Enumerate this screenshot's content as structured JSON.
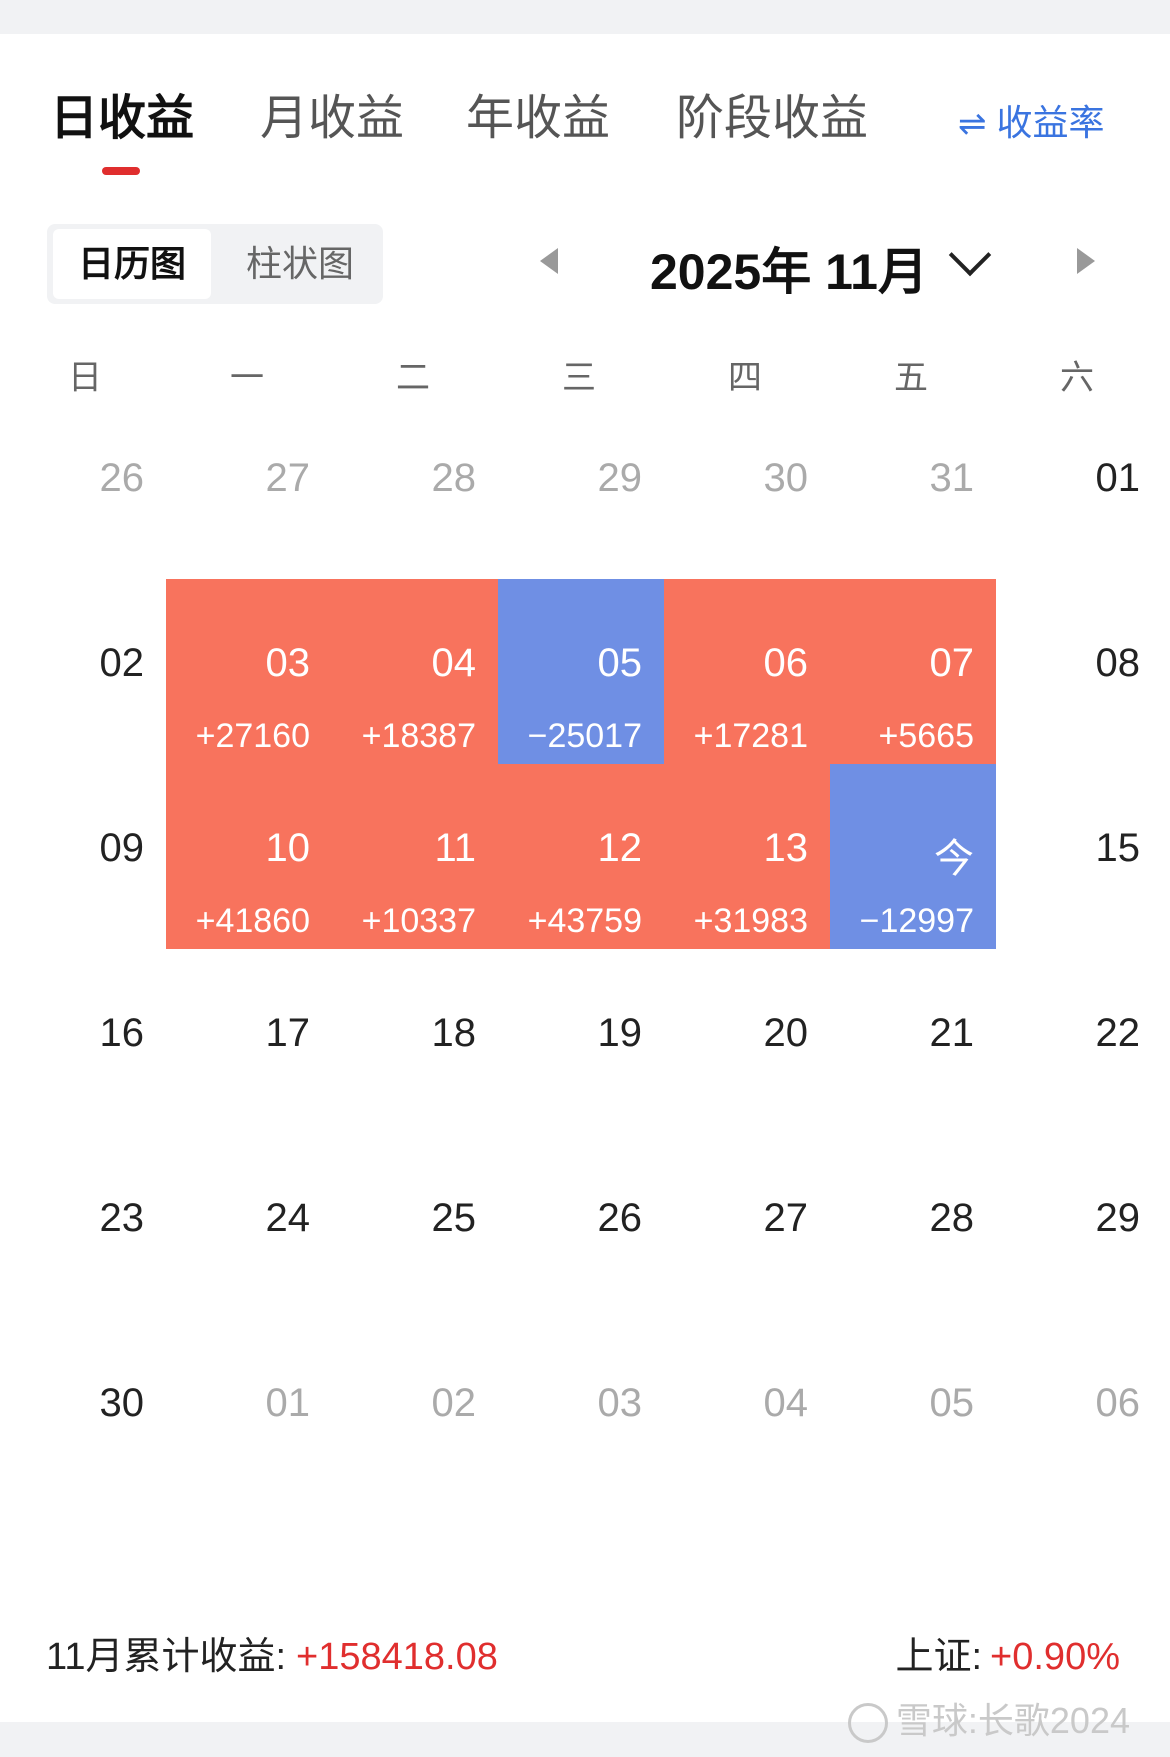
{
  "tabs": [
    {
      "label": "日收益",
      "active": true
    },
    {
      "label": "月收益",
      "active": false
    },
    {
      "label": "年收益",
      "active": false
    },
    {
      "label": "阶段收益",
      "active": false
    }
  ],
  "rate_toggle": {
    "label": "收益率",
    "icon": "swap-icon"
  },
  "view_switch": {
    "calendar": "日历图",
    "bar": "柱状图",
    "selected": "日历图"
  },
  "month_nav": {
    "title": "2025年 11月"
  },
  "weekdays": [
    "日",
    "一",
    "二",
    "三",
    "四",
    "五",
    "六"
  ],
  "calendar": [
    [
      {
        "day": "26",
        "muted": true
      },
      {
        "day": "27",
        "muted": true
      },
      {
        "day": "28",
        "muted": true
      },
      {
        "day": "29",
        "muted": true
      },
      {
        "day": "30",
        "muted": true
      },
      {
        "day": "31",
        "muted": true
      },
      {
        "day": "01"
      }
    ],
    [
      {
        "day": "02"
      },
      {
        "day": "03",
        "value": "+27160",
        "trend": "up"
      },
      {
        "day": "04",
        "value": "+18387",
        "trend": "up"
      },
      {
        "day": "05",
        "value": "−25017",
        "trend": "down"
      },
      {
        "day": "06",
        "value": "+17281",
        "trend": "up"
      },
      {
        "day": "07",
        "value": "+5665",
        "trend": "up"
      },
      {
        "day": "08"
      }
    ],
    [
      {
        "day": "09"
      },
      {
        "day": "10",
        "value": "+41860",
        "trend": "up"
      },
      {
        "day": "11",
        "value": "+10337",
        "trend": "up"
      },
      {
        "day": "12",
        "value": "+43759",
        "trend": "up"
      },
      {
        "day": "13",
        "value": "+31983",
        "trend": "up"
      },
      {
        "day": "今",
        "value": "−12997",
        "trend": "down"
      },
      {
        "day": "15"
      }
    ],
    [
      {
        "day": "16"
      },
      {
        "day": "17"
      },
      {
        "day": "18"
      },
      {
        "day": "19"
      },
      {
        "day": "20"
      },
      {
        "day": "21"
      },
      {
        "day": "22"
      }
    ],
    [
      {
        "day": "23"
      },
      {
        "day": "24"
      },
      {
        "day": "25"
      },
      {
        "day": "26"
      },
      {
        "day": "27"
      },
      {
        "day": "28"
      },
      {
        "day": "29"
      }
    ],
    [
      {
        "day": "30"
      },
      {
        "day": "01",
        "muted": true
      },
      {
        "day": "02",
        "muted": true
      },
      {
        "day": "03",
        "muted": true
      },
      {
        "day": "04",
        "muted": true
      },
      {
        "day": "05",
        "muted": true
      },
      {
        "day": "06",
        "muted": true
      }
    ]
  ],
  "summary": {
    "label": "11月累计收益:",
    "value": "+158418.08"
  },
  "index": {
    "label": "上证:",
    "value": "+0.90%"
  },
  "watermark": "雪球:长歌2024",
  "colors": {
    "up": "#f8735d",
    "down": "#6f8fe4",
    "accent_red": "#e02e2e",
    "link_blue": "#3a74e0"
  }
}
